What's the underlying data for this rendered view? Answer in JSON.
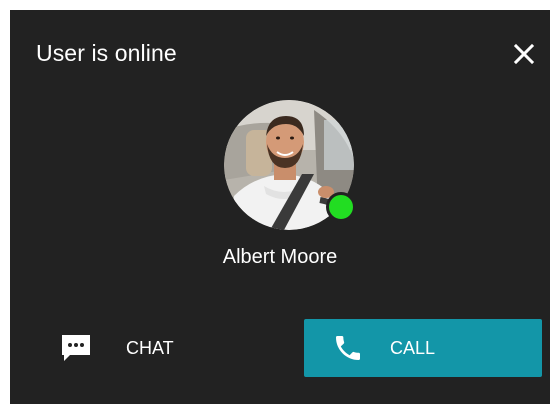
{
  "dialog": {
    "title": "User is online",
    "close_icon": "close-icon",
    "background": "#222222"
  },
  "user": {
    "name": "Albert Moore",
    "avatar_icon": "avatar-photo",
    "status": "online",
    "status_color": "#22dd22"
  },
  "actions": {
    "chat": {
      "label": "CHAT",
      "icon": "chat-bubble-icon"
    },
    "call": {
      "label": "CALL",
      "icon": "phone-icon",
      "color": "#1396a8"
    }
  }
}
